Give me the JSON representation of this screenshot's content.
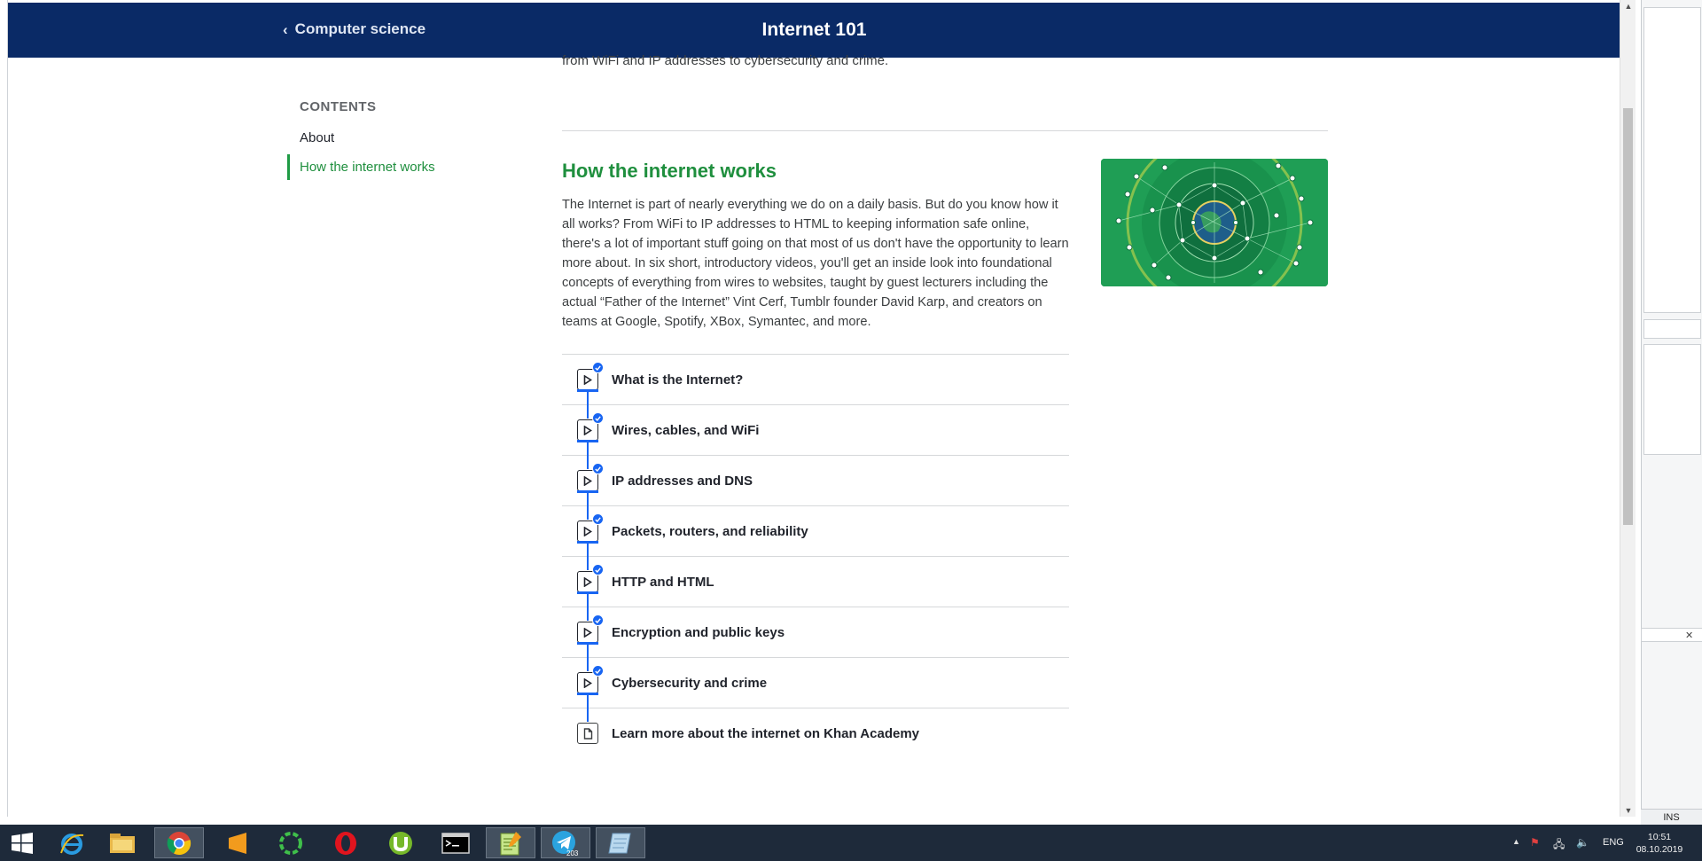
{
  "header": {
    "back_label": "Computer science",
    "title": "Internet 101"
  },
  "intro_tail": "from WiFi and IP addresses to cybersecurity and crime.",
  "sidebar": {
    "heading": "CONTENTS",
    "items": [
      {
        "label": "About",
        "active": false
      },
      {
        "label": "How the internet works",
        "active": true
      }
    ]
  },
  "section": {
    "title": "How the internet works",
    "body": "The Internet is part of nearly everything we do on a daily basis. But do you know how it all works? From WiFi to IP addresses to HTML to keeping information safe online, there's a lot of important stuff going on that most of us don't have the opportunity to learn more about. In six short, introductory videos, you'll get an inside look into foundational concepts of everything from wires to websites, taught by guest lecturers including the actual “Father of the Internet” Vint Cerf, Tumblr founder David Karp, and creators on teams at Google, Spotify, XBox, Symantec, and more."
  },
  "lessons": [
    {
      "label": "What is the Internet?",
      "type": "video",
      "completed": true
    },
    {
      "label": "Wires, cables, and WiFi",
      "type": "video",
      "completed": true
    },
    {
      "label": "IP addresses and DNS",
      "type": "video",
      "completed": true
    },
    {
      "label": "Packets, routers, and reliability",
      "type": "video",
      "completed": true
    },
    {
      "label": "HTTP and HTML",
      "type": "video",
      "completed": true
    },
    {
      "label": "Encryption and public keys",
      "type": "video",
      "completed": true
    },
    {
      "label": "Cybersecurity and crime",
      "type": "video",
      "completed": true
    },
    {
      "label": "Learn more about the internet on Khan Academy",
      "type": "article",
      "completed": false
    }
  ],
  "colors": {
    "header_bg": "#0a2a66",
    "accent_green": "#1f8f3e",
    "progress_blue": "#1865f2"
  },
  "status_panel": {
    "ins": "INS"
  },
  "taskbar": {
    "apps": [
      "start-icon",
      "internet-explorer-icon",
      "file-explorer-icon",
      "chrome-icon",
      "sublime-text-icon",
      "green-ring-app-icon",
      "opera-icon",
      "utorrent-icon",
      "command-prompt-icon",
      "notepad-plus-plus-icon",
      "telegram-icon",
      "notes-app-icon"
    ],
    "telegram_badge": "203",
    "language": "ENG",
    "time": "10:51",
    "date": "08.10.2019"
  }
}
